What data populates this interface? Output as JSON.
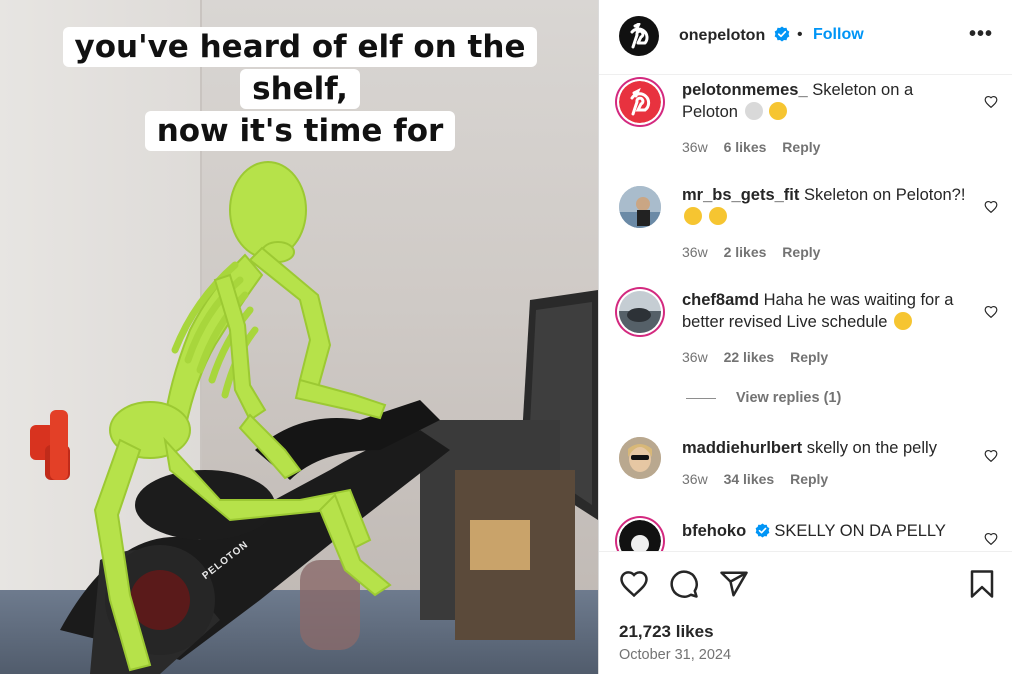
{
  "media": {
    "caption_line1": "you've heard of elf on the shelf,",
    "caption_line2": "now it's time for",
    "bike_brand": "PELOTON"
  },
  "header": {
    "username": "onepeloton",
    "verified": true,
    "separator": "•",
    "follow_label": "Follow",
    "more_label": "•••"
  },
  "comments": [
    {
      "username": "pelotonmemes_",
      "text": "Skeleton on a Peloton",
      "emojis": [
        "skull",
        "heart-eyes"
      ],
      "time": "36w",
      "likes": "6 likes",
      "reply": "Reply"
    },
    {
      "username": "mr_bs_gets_fit",
      "text": "Skeleton on Peloton?!",
      "emojis": [
        "thinking",
        "sweat-smile"
      ],
      "time": "36w",
      "likes": "2 likes",
      "reply": "Reply"
    },
    {
      "username": "chef8amd",
      "text": "Haha he was waiting for a better revised Live schedule",
      "emojis": [
        "joy"
      ],
      "time": "36w",
      "likes": "22 likes",
      "reply": "Reply",
      "view_replies": "View replies (1)"
    },
    {
      "username": "maddiehurlbert",
      "text": "skelly on the pelly",
      "time": "36w",
      "likes": "34 likes",
      "reply": "Reply"
    },
    {
      "username": "bfehoko",
      "verified": true,
      "text": "SKELLY ON DA PELLY"
    }
  ],
  "footer": {
    "likes": "21,723 likes",
    "date": "October 31, 2024"
  },
  "colors": {
    "link_blue": "#0095f6",
    "verified_blue": "#0095f6",
    "muted_text": "#737373",
    "skeleton_green": "#b6e24a"
  },
  "icons": [
    "peloton-logo-icon",
    "verified-icon",
    "more-icon",
    "heart-icon",
    "comment-icon",
    "share-icon",
    "bookmark-icon"
  ]
}
